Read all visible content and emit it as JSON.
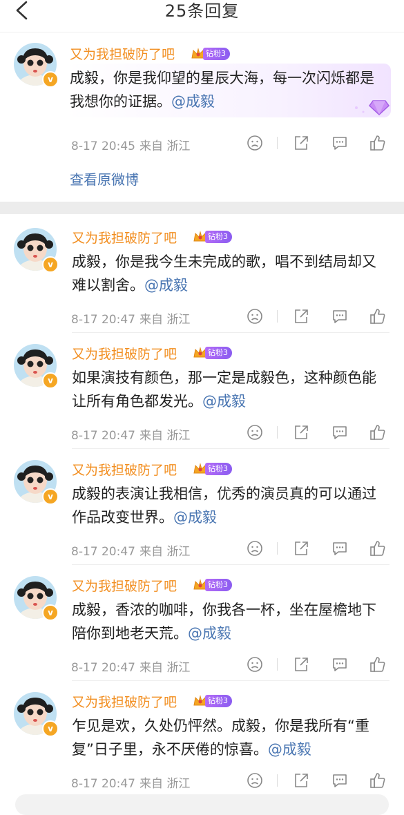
{
  "header": {
    "title": "25条回复"
  },
  "view_original": "查看原微博",
  "colors": {
    "username": "#f28f22",
    "mention": "#4a76b2",
    "meta": "#999999",
    "badge": "#8a5cf0"
  },
  "comments": [
    {
      "user": "又为我担破防了吧",
      "fan_badge": "钻粉3",
      "text": "成毅，你是我仰望的星辰大海，每一次闪烁都是我想你的证据。",
      "mention": "@成毅",
      "time": "8-17 20:45",
      "location": "来自 浙江"
    },
    {
      "user": "又为我担破防了吧",
      "fan_badge": "钻粉3",
      "text": "成毅，你是我今生未完成的歌，唱不到结局却又难以割舍。",
      "mention": "@成毅",
      "time": "8-17 20:47",
      "location": "来自 浙江"
    },
    {
      "user": "又为我担破防了吧",
      "fan_badge": "钻粉3",
      "text": "如果演技有颜色，那一定是成毅色，这种颜色能让所有角色都发光。",
      "mention": "@成毅",
      "time": "8-17 20:47",
      "location": "来自 浙江"
    },
    {
      "user": "又为我担破防了吧",
      "fan_badge": "钻粉3",
      "text": "成毅的表演让我相信，优秀的演员真的可以通过作品改变世界。",
      "mention": "@成毅",
      "time": "8-17 20:47",
      "location": "来自 浙江"
    },
    {
      "user": "又为我担破防了吧",
      "fan_badge": "钻粉3",
      "text": "成毅，香浓的咖啡，你我各一杯，坐在屋檐地下陪你到地老天荒。",
      "mention": "@成毅",
      "time": "8-17 20:47",
      "location": "来自 浙江"
    },
    {
      "user": "又为我担破防了吧",
      "fan_badge": "钻粉3",
      "text": "乍见是欢，久处仍怦然。成毅，你是我所有“重复”日子里，永不厌倦的惊喜。",
      "mention": "@成毅",
      "time": "8-17 20:47",
      "location": "来自 浙江"
    }
  ]
}
